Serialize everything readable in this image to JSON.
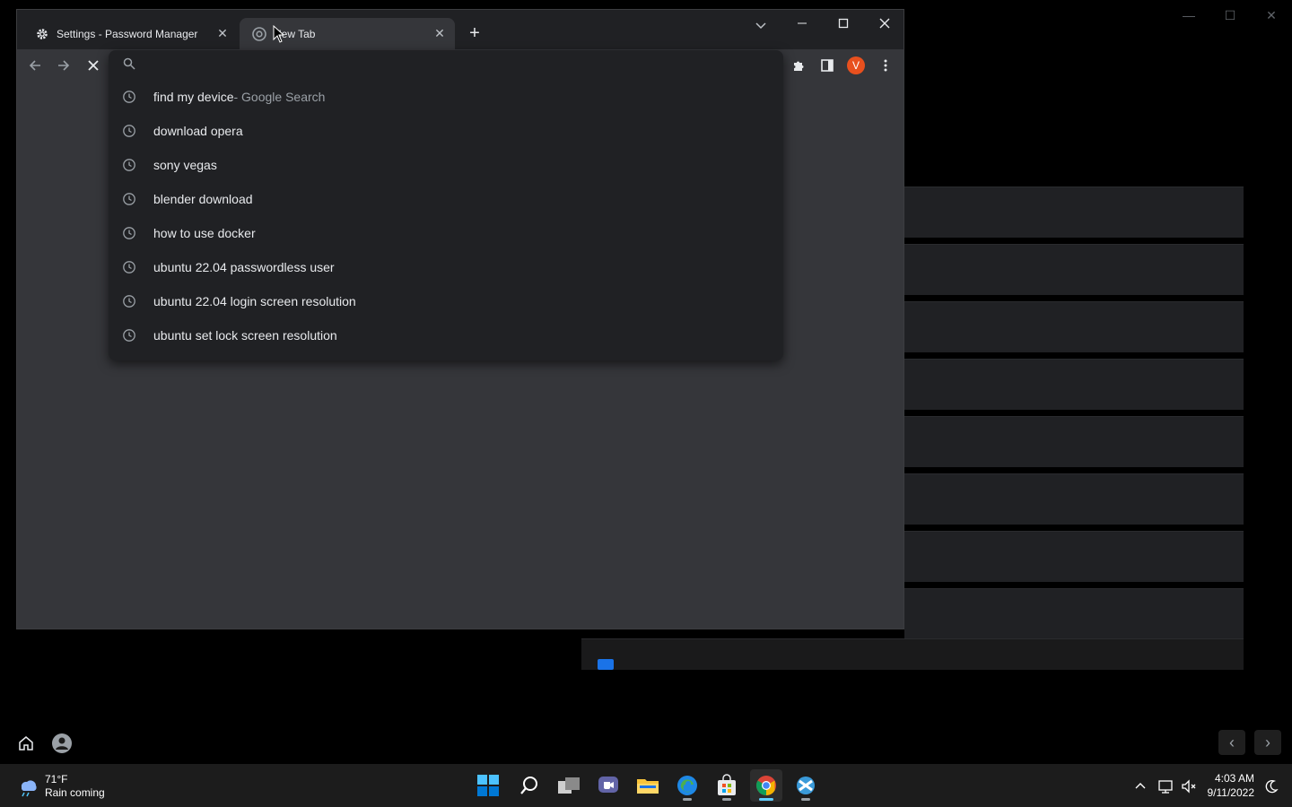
{
  "background_window": {
    "controls": [
      "—",
      "☐",
      "✕"
    ],
    "home_icon": "home-icon",
    "user_icon": "person-icon",
    "prev_icon": "‹",
    "next_icon": "›"
  },
  "browser": {
    "tabs": [
      {
        "title": "Settings - Password Manager",
        "icon": "gear-icon",
        "close": "✕"
      },
      {
        "title": "New Tab",
        "icon": "chrome-icon",
        "close": "✕"
      }
    ],
    "new_tab_label": "+",
    "profile_initial": "V",
    "omnibox": {
      "value": "",
      "suggestions": [
        {
          "text": "find my device",
          "description": " - Google Search"
        },
        {
          "text": "download opera",
          "description": ""
        },
        {
          "text": "sony vegas",
          "description": ""
        },
        {
          "text": "blender download",
          "description": ""
        },
        {
          "text": "how to use docker",
          "description": ""
        },
        {
          "text": "ubuntu 22.04 passwordless user",
          "description": ""
        },
        {
          "text": "ubuntu 22.04 login screen resolution",
          "description": ""
        },
        {
          "text": "ubuntu set lock screen resolution",
          "description": ""
        }
      ]
    }
  },
  "taskbar": {
    "weather": {
      "temp": "71°F",
      "condition": "Rain coming"
    },
    "apps": [
      "start",
      "search",
      "task-view",
      "teams-chat",
      "file-explorer",
      "edge",
      "store",
      "chrome",
      "app"
    ],
    "clock": {
      "time": "4:03 AM",
      "date": "9/11/2022"
    }
  }
}
